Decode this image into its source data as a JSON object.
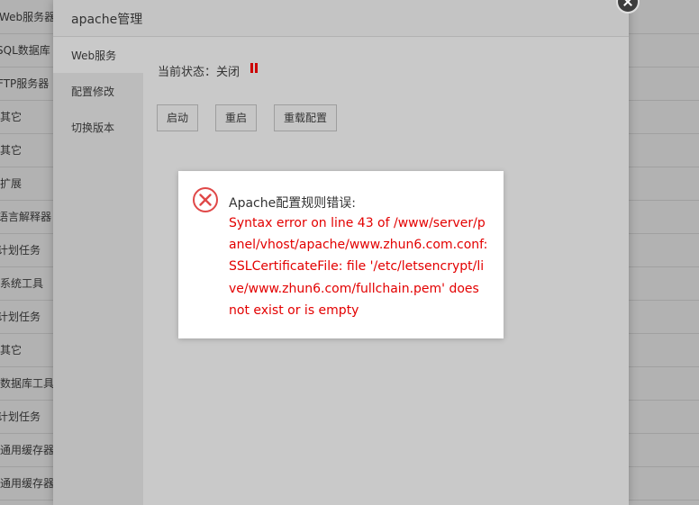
{
  "background_list": [
    "Web服务器",
    "SQL数据库",
    "FTP服务器",
    "其它",
    "其它",
    "扩展",
    "语言解释器",
    "计划任务",
    "系统工具",
    "计划任务",
    "其它",
    "数据库工具",
    "计划任务",
    "通用缓存器",
    "通用缓存器"
  ],
  "panel": {
    "title": "apache管理",
    "sidebar": [
      {
        "label": "Web服务"
      },
      {
        "label": "配置修改"
      },
      {
        "label": "切换版本"
      }
    ],
    "status_text": "当前状态：关闭",
    "status_color": "#cc0000",
    "buttons": [
      {
        "label": "启动"
      },
      {
        "label": "重启"
      },
      {
        "label": "重载配置"
      }
    ]
  },
  "error_dialog": {
    "icon": "error-x-circle-icon",
    "title": "Apache配置规则错误:",
    "message": "Syntax error on line 43 of /www/server/panel/vhost/apache/www.zhun6.com.conf: SSLCertificateFile: file '/etc/letsencrypt/live/www.zhun6.com/fullchain.pem' does not exist or is empty",
    "message_color": "#e30000"
  }
}
